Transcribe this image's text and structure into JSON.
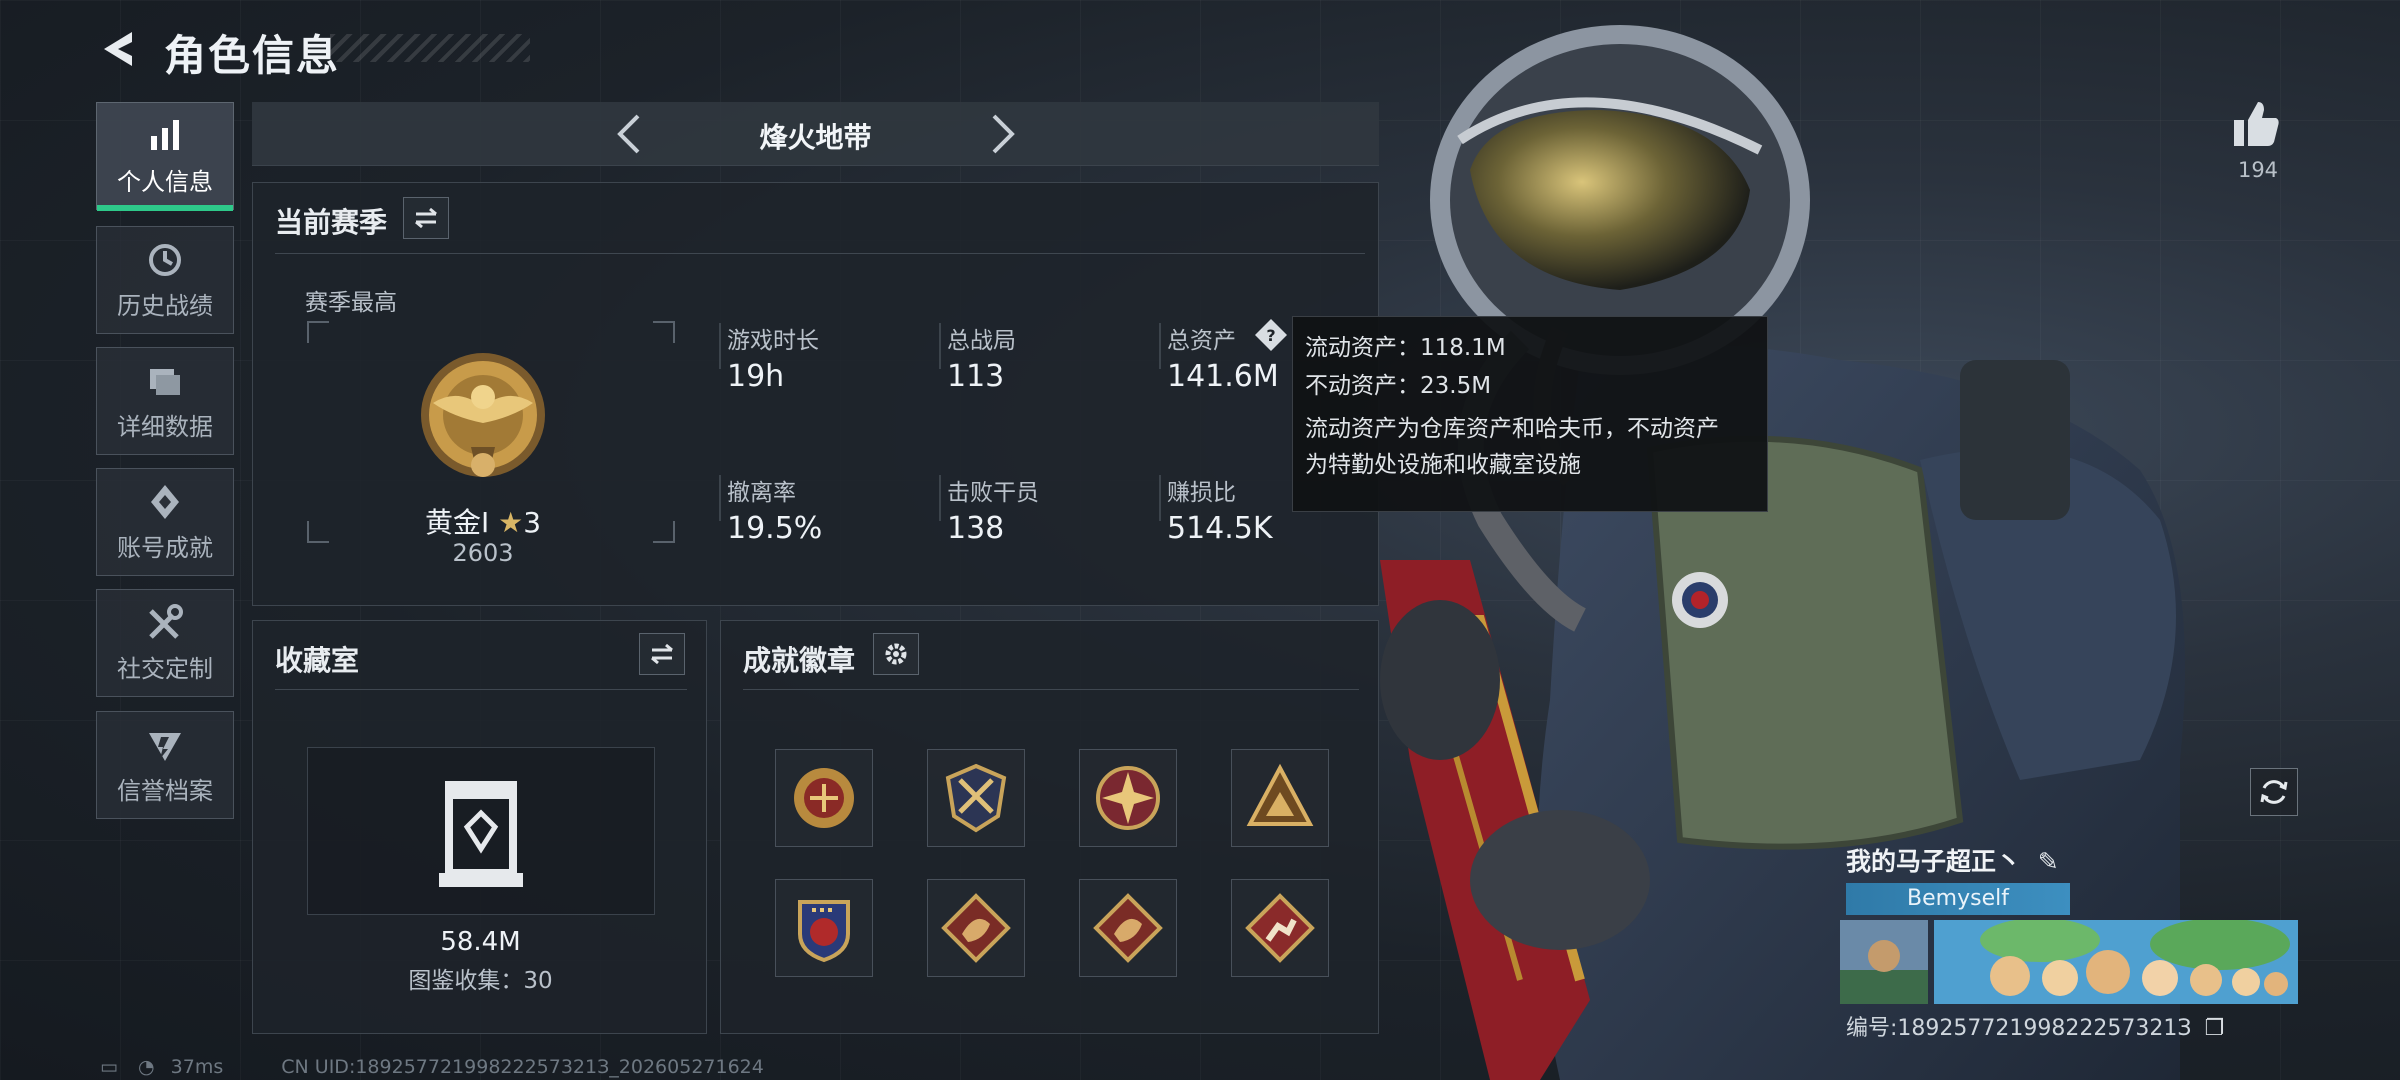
{
  "header": {
    "title": "角色信息"
  },
  "sidebar": {
    "items": [
      {
        "label": "个人信息",
        "icon": "bar-chart-icon",
        "active": true
      },
      {
        "label": "历史战绩",
        "icon": "history-clock-icon",
        "active": false
      },
      {
        "label": "详细数据",
        "icon": "data-folder-icon",
        "active": false
      },
      {
        "label": "账号成就",
        "icon": "achievement-icon",
        "active": false
      },
      {
        "label": "社交定制",
        "icon": "tools-icon",
        "active": false
      },
      {
        "label": "信誉档案",
        "icon": "reputation-icon",
        "active": false
      }
    ]
  },
  "mode": {
    "name": "烽火地带"
  },
  "season": {
    "title": "当前赛季",
    "best_label": "赛季最高",
    "rank_name": "黄金Ⅰ",
    "rank_stars": "3",
    "rank_score": "2603",
    "stats": [
      {
        "label": "游戏时长",
        "value": "19h"
      },
      {
        "label": "总战局",
        "value": "113"
      },
      {
        "label": "总资产",
        "value": "141.6M"
      },
      {
        "label": "撤离率",
        "value": "19.5%"
      },
      {
        "label": "击败干员",
        "value": "138"
      },
      {
        "label": "赚损比",
        "value": "514.5K"
      }
    ]
  },
  "tooltip": {
    "liquid": "流动资产：118.1M",
    "fixed": "不动资产：23.5M",
    "desc_line1": "流动资产为仓库资产和哈夫币，不动资产",
    "desc_line2": "为特勤处设施和收藏室设施"
  },
  "collection": {
    "title": "收藏室",
    "value": "58.4M",
    "count_text": "图鉴收集：30"
  },
  "achievements": {
    "title": "成就徽章",
    "badges": [
      "eagle-crest-badge-icon",
      "crossed-arrows-badge-icon",
      "star-compass-badge-icon",
      "mountain-badge-icon",
      "star-shield-badge-icon",
      "dragon-badge-icon",
      "dragon-badge-icon",
      "runner-badge-icon"
    ]
  },
  "profile": {
    "likes": "194",
    "name": "我的马子超正丶",
    "tag": "Bemyself",
    "id_text": "编号:18925772199822257321З"
  },
  "status": {
    "ping": "37ms",
    "uid": "CN UID:18925772199822257321З_202605271624"
  },
  "colors": {
    "accent": "#2ec98a",
    "tag_blue": "#3d8fc0",
    "gold": "#c89b4a"
  }
}
